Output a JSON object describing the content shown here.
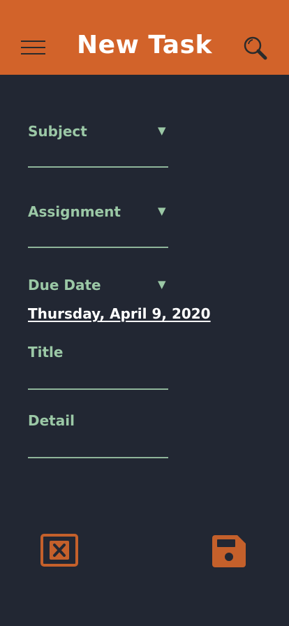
{
  "header": {
    "title": "New Task",
    "menu_icon": "hamburger-menu-icon",
    "search_icon": "search-icon",
    "background_color": "#d2632a"
  },
  "form": {
    "subject": {
      "label": "Subject",
      "dropdown_icon": "dropdown-arrow-icon"
    },
    "assignment": {
      "label": "Assignment",
      "dropdown_icon": "dropdown-arrow-icon"
    },
    "due_date": {
      "label": "Due Date",
      "dropdown_icon": "dropdown-arrow-icon",
      "value": "Thursday, April 9, 2020"
    },
    "title": {
      "label": "Title",
      "value": ""
    },
    "detail": {
      "label": "Detail",
      "value": ""
    }
  },
  "actions": {
    "cancel_icon": "close-square-icon",
    "save_icon": "floppy-disk-save-icon",
    "accent_color": "#c4602b"
  },
  "colors": {
    "background": "#222733",
    "label": "#9bc8a6"
  }
}
